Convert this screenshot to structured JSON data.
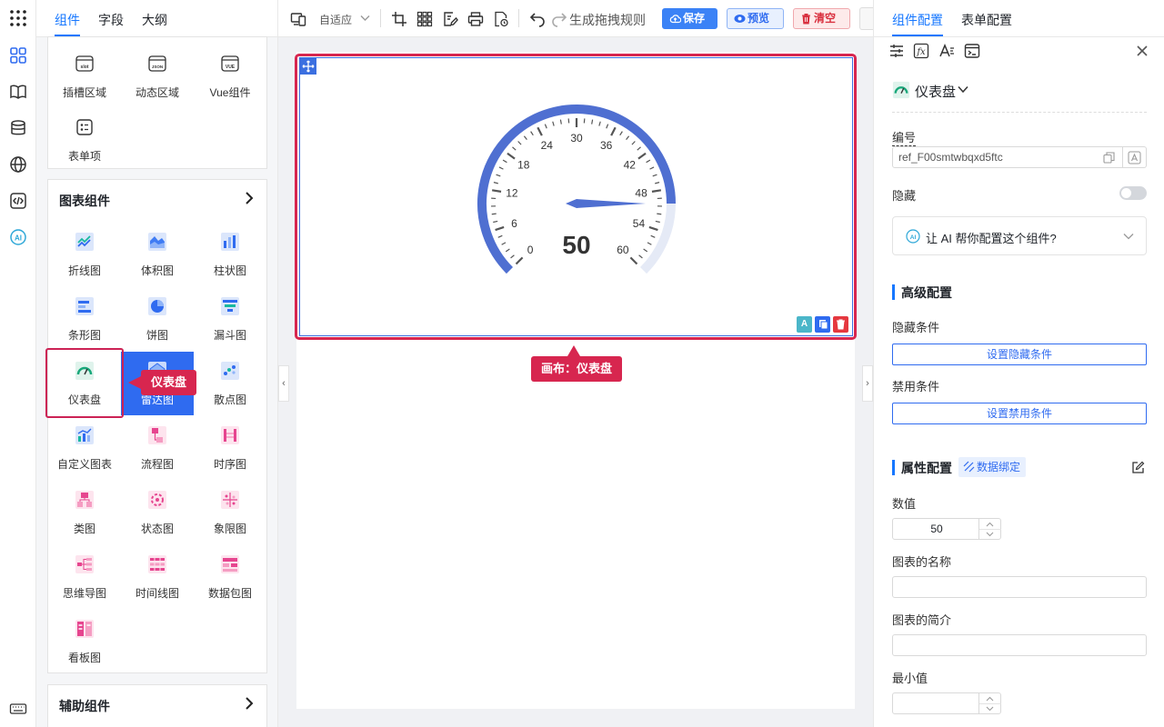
{
  "rail": {
    "items": [
      "grid-apps",
      "components",
      "outline-book",
      "database",
      "globe",
      "code",
      "ai"
    ]
  },
  "palette": {
    "tabs": [
      "组件",
      "字段",
      "大纲"
    ],
    "top_items": [
      "插槽区域",
      "动态区域",
      "Vue组件",
      "表单项"
    ],
    "top_badges": [
      "slot",
      "JSON",
      "VUE"
    ],
    "chart_section": {
      "title": "图表组件",
      "items": [
        "折线图",
        "体积图",
        "柱状图",
        "条形图",
        "饼图",
        "漏斗图",
        "仪表盘",
        "雷达图",
        "散点图",
        "自定义图表",
        "流程图",
        "时序图",
        "类图",
        "状态图",
        "象限图",
        "思维导图",
        "时间线图",
        "数据包图",
        "看板图"
      ]
    },
    "aux_section": {
      "title": "辅助组件"
    },
    "callout": "仪表盘"
  },
  "toolbar": {
    "adapt_label": "自适应",
    "generate_label": "生成拖拽规则",
    "save_label": "保存",
    "preview_label": "预览",
    "clear_label": "清空"
  },
  "canvas": {
    "callout": "画布：仪表盘",
    "gauge": {
      "value": "50",
      "min": 0,
      "max": 60,
      "tick_labels": [
        "0",
        "6",
        "12",
        "18",
        "24",
        "30",
        "36",
        "42",
        "48",
        "54",
        "60"
      ],
      "colors": {
        "fill": "#4f6fd1",
        "rest": "#e5eaf6",
        "pointer": "#4f6fd1"
      }
    },
    "tool_ai": "A"
  },
  "props": {
    "tabs": [
      "组件配置",
      "表单配置"
    ],
    "component_name": "仪表盘",
    "id_label": "编号",
    "id_value": "ref_F00smtwbqxd5ftc",
    "hidden_label": "隐藏",
    "ai_prompt": "让 AI 帮你配置这个组件?",
    "advanced_title": "高级配置",
    "hide_cond_label": "隐藏条件",
    "hide_cond_button": "设置隐藏条件",
    "disable_cond_label": "禁用条件",
    "disable_cond_button": "设置禁用条件",
    "attr_title": "属性配置",
    "data_bind_label": "数据绑定",
    "value_label": "数值",
    "value": "50",
    "chart_name_label": "图表的名称",
    "chart_desc_label": "图表的简介",
    "min_label": "最小值"
  }
}
